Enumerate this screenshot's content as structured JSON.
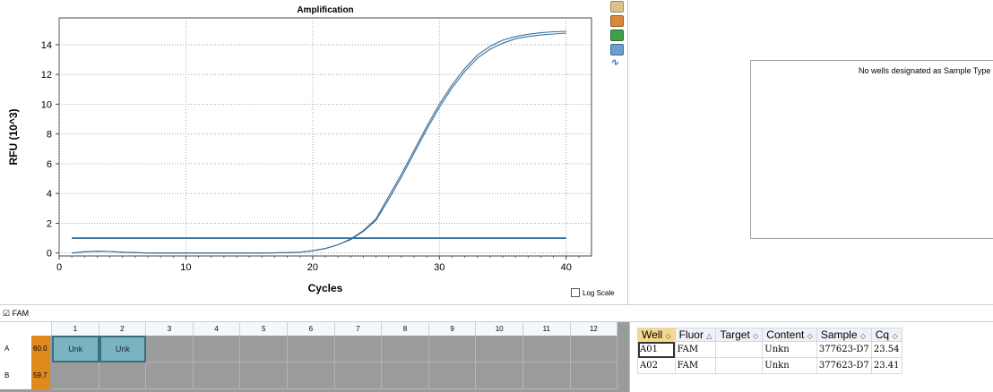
{
  "chart_data": {
    "type": "line",
    "title": "Amplification",
    "xlabel": "Cycles",
    "ylabel": "RFU (10^3)",
    "xlim": [
      0,
      42
    ],
    "ylim": [
      -0.2,
      15.8
    ],
    "xticks": [
      0,
      10,
      20,
      30,
      40
    ],
    "yticks": [
      0,
      2,
      4,
      6,
      8,
      10,
      12,
      14
    ],
    "grid": true,
    "threshold": 1.0,
    "series": [
      {
        "x": [
          1,
          2,
          3,
          4,
          5,
          6,
          7,
          8,
          10,
          12,
          14,
          16,
          18,
          19,
          20,
          21,
          22,
          23,
          24,
          25,
          26,
          27,
          28,
          29,
          30,
          31,
          32,
          33,
          34,
          35,
          36,
          37,
          38,
          39,
          40
        ],
        "y": [
          0,
          0.08,
          0.12,
          0.1,
          0.05,
          0.02,
          0,
          0,
          0,
          0,
          0,
          0,
          0.02,
          0.05,
          0.15,
          0.3,
          0.55,
          0.95,
          1.5,
          2.3,
          3.8,
          5.3,
          6.9,
          8.5,
          10.0,
          11.3,
          12.4,
          13.3,
          13.9,
          14.3,
          14.55,
          14.7,
          14.8,
          14.87,
          14.9
        ]
      },
      {
        "x": [
          1,
          2,
          3,
          4,
          5,
          6,
          7,
          8,
          10,
          12,
          14,
          16,
          18,
          19,
          20,
          21,
          22,
          23,
          24,
          25,
          26,
          27,
          28,
          29,
          30,
          31,
          32,
          33,
          34,
          35,
          36,
          37,
          38,
          39,
          40
        ],
        "y": [
          0,
          0.08,
          0.12,
          0.1,
          0.05,
          0.02,
          0,
          0,
          0,
          0,
          0,
          0,
          0.02,
          0.05,
          0.15,
          0.3,
          0.55,
          0.9,
          1.45,
          2.2,
          3.6,
          5.1,
          6.7,
          8.3,
          9.8,
          11.1,
          12.2,
          13.1,
          13.7,
          14.1,
          14.4,
          14.55,
          14.65,
          14.72,
          14.78
        ]
      }
    ]
  },
  "log_scale_label": "Log Scale",
  "std_panel": {
    "message": "No wells designated as Sample Type stan"
  },
  "fluor_label": "FAM",
  "plate": {
    "columns": [
      "1",
      "2",
      "3",
      "4",
      "5",
      "6",
      "7",
      "8",
      "9",
      "10",
      "11",
      "12"
    ],
    "rows": [
      {
        "label": "A",
        "temp": "60.0",
        "wells": [
          "Unk",
          "Unk",
          "",
          "",
          "",
          "",
          "",
          "",
          "",
          "",
          "",
          ""
        ]
      },
      {
        "label": "B",
        "temp": "59.7",
        "wells": [
          "",
          "",
          "",
          "",
          "",
          "",
          "",
          "",
          "",
          "",
          "",
          ""
        ]
      }
    ]
  },
  "table": {
    "headers": [
      "Well",
      "Fluor",
      "Target",
      "Content",
      "Sample",
      "Cq"
    ],
    "header_sort_icons": [
      "◇",
      "△",
      "◇",
      "◇",
      "◇",
      "◇"
    ],
    "rows": [
      [
        "A01",
        "FAM",
        "",
        "Unkn",
        "377623-D7",
        "23.54"
      ],
      [
        "A02",
        "FAM",
        "",
        "Unkn",
        "377623-D7",
        "23.41"
      ]
    ]
  },
  "colors": {
    "curve": "#3a6f9a",
    "threshold": "#1d5a8a",
    "well_fill": "#7ab3c1",
    "temp_col": "#e08a1e"
  }
}
